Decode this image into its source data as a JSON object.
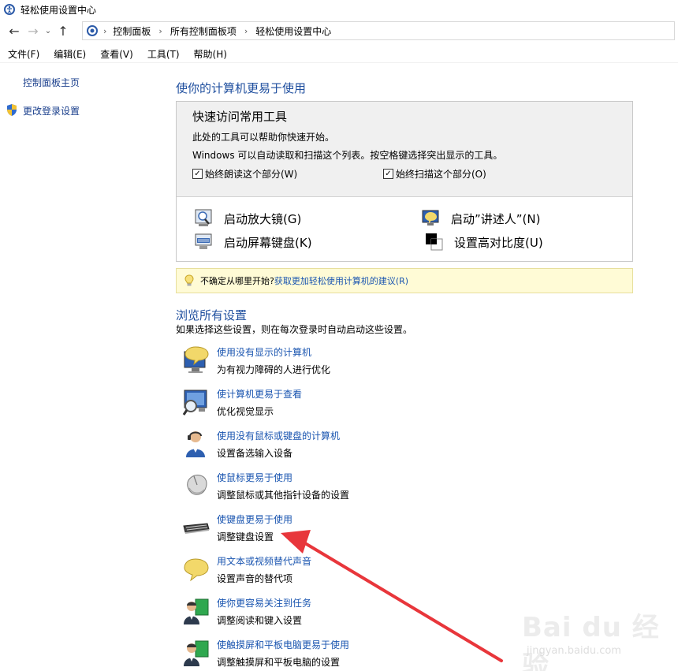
{
  "window": {
    "title": "轻松使用设置中心"
  },
  "breadcrumb": [
    "控制面板",
    "所有控制面板项",
    "轻松使用设置中心"
  ],
  "menu": [
    "文件(F)",
    "编辑(E)",
    "查看(V)",
    "工具(T)",
    "帮助(H)"
  ],
  "sidebar": {
    "home_link": "控制面板主页",
    "login_link": "更改登录设置"
  },
  "main": {
    "title": "使你的计算机更易于使用"
  },
  "quick_access": {
    "title": "快速访问常用工具",
    "desc1": "此处的工具可以帮助你快速开始。",
    "desc2": "Windows 可以自动读取和扫描这个列表。按空格键选择突出显示的工具。",
    "check_read": "始终朗读这个部分(W)",
    "check_scan": "始终扫描这个部分(O)",
    "check_read_checked": true,
    "check_scan_checked": true,
    "tools": {
      "magnifier": "启动放大镜(G)",
      "narrator": "启动”讲述人”(N)",
      "osk": "启动屏幕键盘(K)",
      "contrast": "设置高对比度(U)"
    }
  },
  "hint": {
    "text": "不确定从哪里开始?",
    "link": "获取更加轻松使用计算机的建议(R)"
  },
  "browse": {
    "title": "浏览所有设置",
    "desc": "如果选择这些设置，则在每次登录时自动启动这些设置。",
    "items": [
      {
        "link": "使用没有显示的计算机",
        "desc": "为有视力障碍的人进行优化",
        "icon": "display-speech-icon"
      },
      {
        "link": "使计算机更易于查看",
        "desc": "优化视觉显示",
        "icon": "monitor-magnifier-icon"
      },
      {
        "link": "使用没有鼠标或键盘的计算机",
        "desc": "设置备选输入设备",
        "icon": "person-headset-icon"
      },
      {
        "link": "使鼠标更易于使用",
        "desc": "调整鼠标或其他指针设备的设置",
        "icon": "mouse-icon"
      },
      {
        "link": "使键盘更易于使用",
        "desc": "调整键盘设置",
        "icon": "keyboard-icon"
      },
      {
        "link": "用文本或视频替代声音",
        "desc": "设置声音的替代项",
        "icon": "speech-bubble-icon"
      },
      {
        "link": "使你更容易关注到任务",
        "desc": "调整阅读和键入设置",
        "icon": "person-board-icon"
      },
      {
        "link": "使触摸屏和平板电脑更易于使用",
        "desc": "调整触摸屏和平板电脑的设置",
        "icon": "person-tablet-icon"
      }
    ]
  },
  "annotation": {
    "color": "#e8363b"
  },
  "watermark": {
    "logo": "Bai du 经验",
    "sub": "jingyan.baidu.com"
  }
}
